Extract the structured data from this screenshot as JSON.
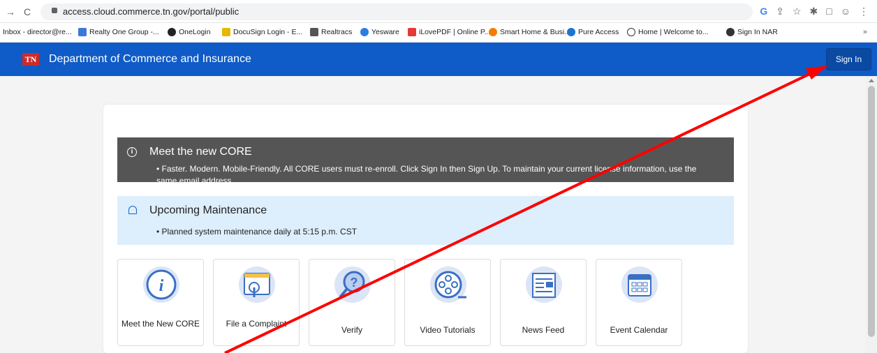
{
  "browser": {
    "url": "access.cloud.commerce.tn.gov/portal/public",
    "bookmarks": [
      {
        "label": "Inbox - director@re..."
      },
      {
        "label": "Realty One Group -..."
      },
      {
        "label": "OneLogin"
      },
      {
        "label": "DocuSign Login - E..."
      },
      {
        "label": "Realtracs"
      },
      {
        "label": "Yesware"
      },
      {
        "label": "iLovePDF | Online P..."
      },
      {
        "label": "Smart Home & Busi..."
      },
      {
        "label": "Pure Access"
      },
      {
        "label": "Home | Welcome to..."
      },
      {
        "label": "Sign In NAR"
      }
    ],
    "more": "»"
  },
  "header": {
    "logo_text": "TN",
    "title": "Department of Commerce and Insurance",
    "signin_label": "Sign In",
    "color": "#0f5bc7"
  },
  "alerts": {
    "core": {
      "title": "Meet the new CORE",
      "body": "Faster. Modern. Mobile-Friendly. All CORE users must re-enroll. Click Sign In then Sign Up. To maintain your current license information, use the same email address."
    },
    "maintenance": {
      "title": "Upcoming Maintenance",
      "body": "Planned system maintenance daily at 5:15 p.m. CST"
    }
  },
  "tiles": [
    {
      "label": "Meet the New CORE",
      "icon": "info-bubble-icon"
    },
    {
      "label": "File a Complaint",
      "icon": "complaint-hand-icon"
    },
    {
      "label": "Verify",
      "icon": "magnifier-question-icon"
    },
    {
      "label": "Video Tutorials",
      "icon": "film-reel-icon"
    },
    {
      "label": "News Feed",
      "icon": "newspaper-icon"
    },
    {
      "label": "Event Calendar",
      "icon": "calendar-icon"
    }
  ],
  "annotation": {
    "color": "#ff0000"
  }
}
